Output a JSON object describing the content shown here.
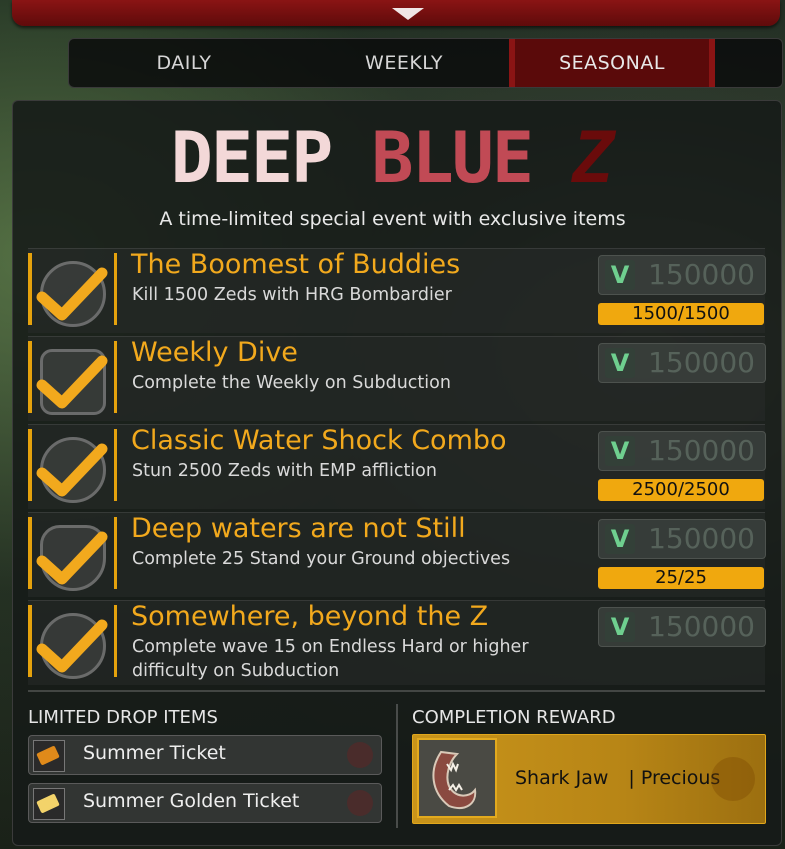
{
  "tabs": [
    {
      "label": "DAILY",
      "active": false
    },
    {
      "label": "WEEKLY",
      "active": false
    },
    {
      "label": "SEASONAL",
      "active": true
    }
  ],
  "event": {
    "logo_word1": "DEEP",
    "logo_word2": "BLUE",
    "logo_word3": "Z",
    "subtitle": "A time-limited special event with exclusive items"
  },
  "currency_icon": "vault-dosh-icon",
  "challenges": [
    {
      "title": "The Boomest of Buddies",
      "description": "Kill 1500 Zeds with HRG Bombardier",
      "reward": "150000",
      "progress": "1500/1500",
      "completed": true,
      "icon": "bombardier-icon"
    },
    {
      "title": "Weekly Dive",
      "description": "Complete the Weekly on Subduction",
      "reward": "150000",
      "progress": "",
      "completed": true,
      "icon": "weekly-icon"
    },
    {
      "title": "Classic Water Shock Combo",
      "description": "Stun 2500 Zeds with EMP affliction",
      "reward": "150000",
      "progress": "2500/2500",
      "completed": true,
      "icon": "emp-icon"
    },
    {
      "title": "Deep waters are not Still",
      "description": "Complete 25 Stand your Ground objectives",
      "reward": "150000",
      "progress": "25/25",
      "completed": true,
      "icon": "shield-icon"
    },
    {
      "title": "Somewhere, beyond the Z",
      "description": "Complete wave 15 on Endless Hard or higher difficulty on Subduction",
      "reward": "150000",
      "progress": "",
      "completed": true,
      "icon": "skull-icon"
    }
  ],
  "limited_drop": {
    "label": "LIMITED DROP ITEMS",
    "items": [
      {
        "name": "Summer Ticket",
        "icon": "ticket-icon"
      },
      {
        "name": "Summer Golden Ticket",
        "icon": "golden-ticket-icon"
      }
    ]
  },
  "completion_reward": {
    "label": "COMPLETION REWARD",
    "item_name": "Shark Jaw",
    "rarity": "|  Precious",
    "icon": "shark-jaw-icon"
  },
  "colors": {
    "accent": "#f2a91d",
    "tab_active": "#5a0a0a",
    "top_bar": "#8a1414",
    "progress": "#f0a80e"
  }
}
